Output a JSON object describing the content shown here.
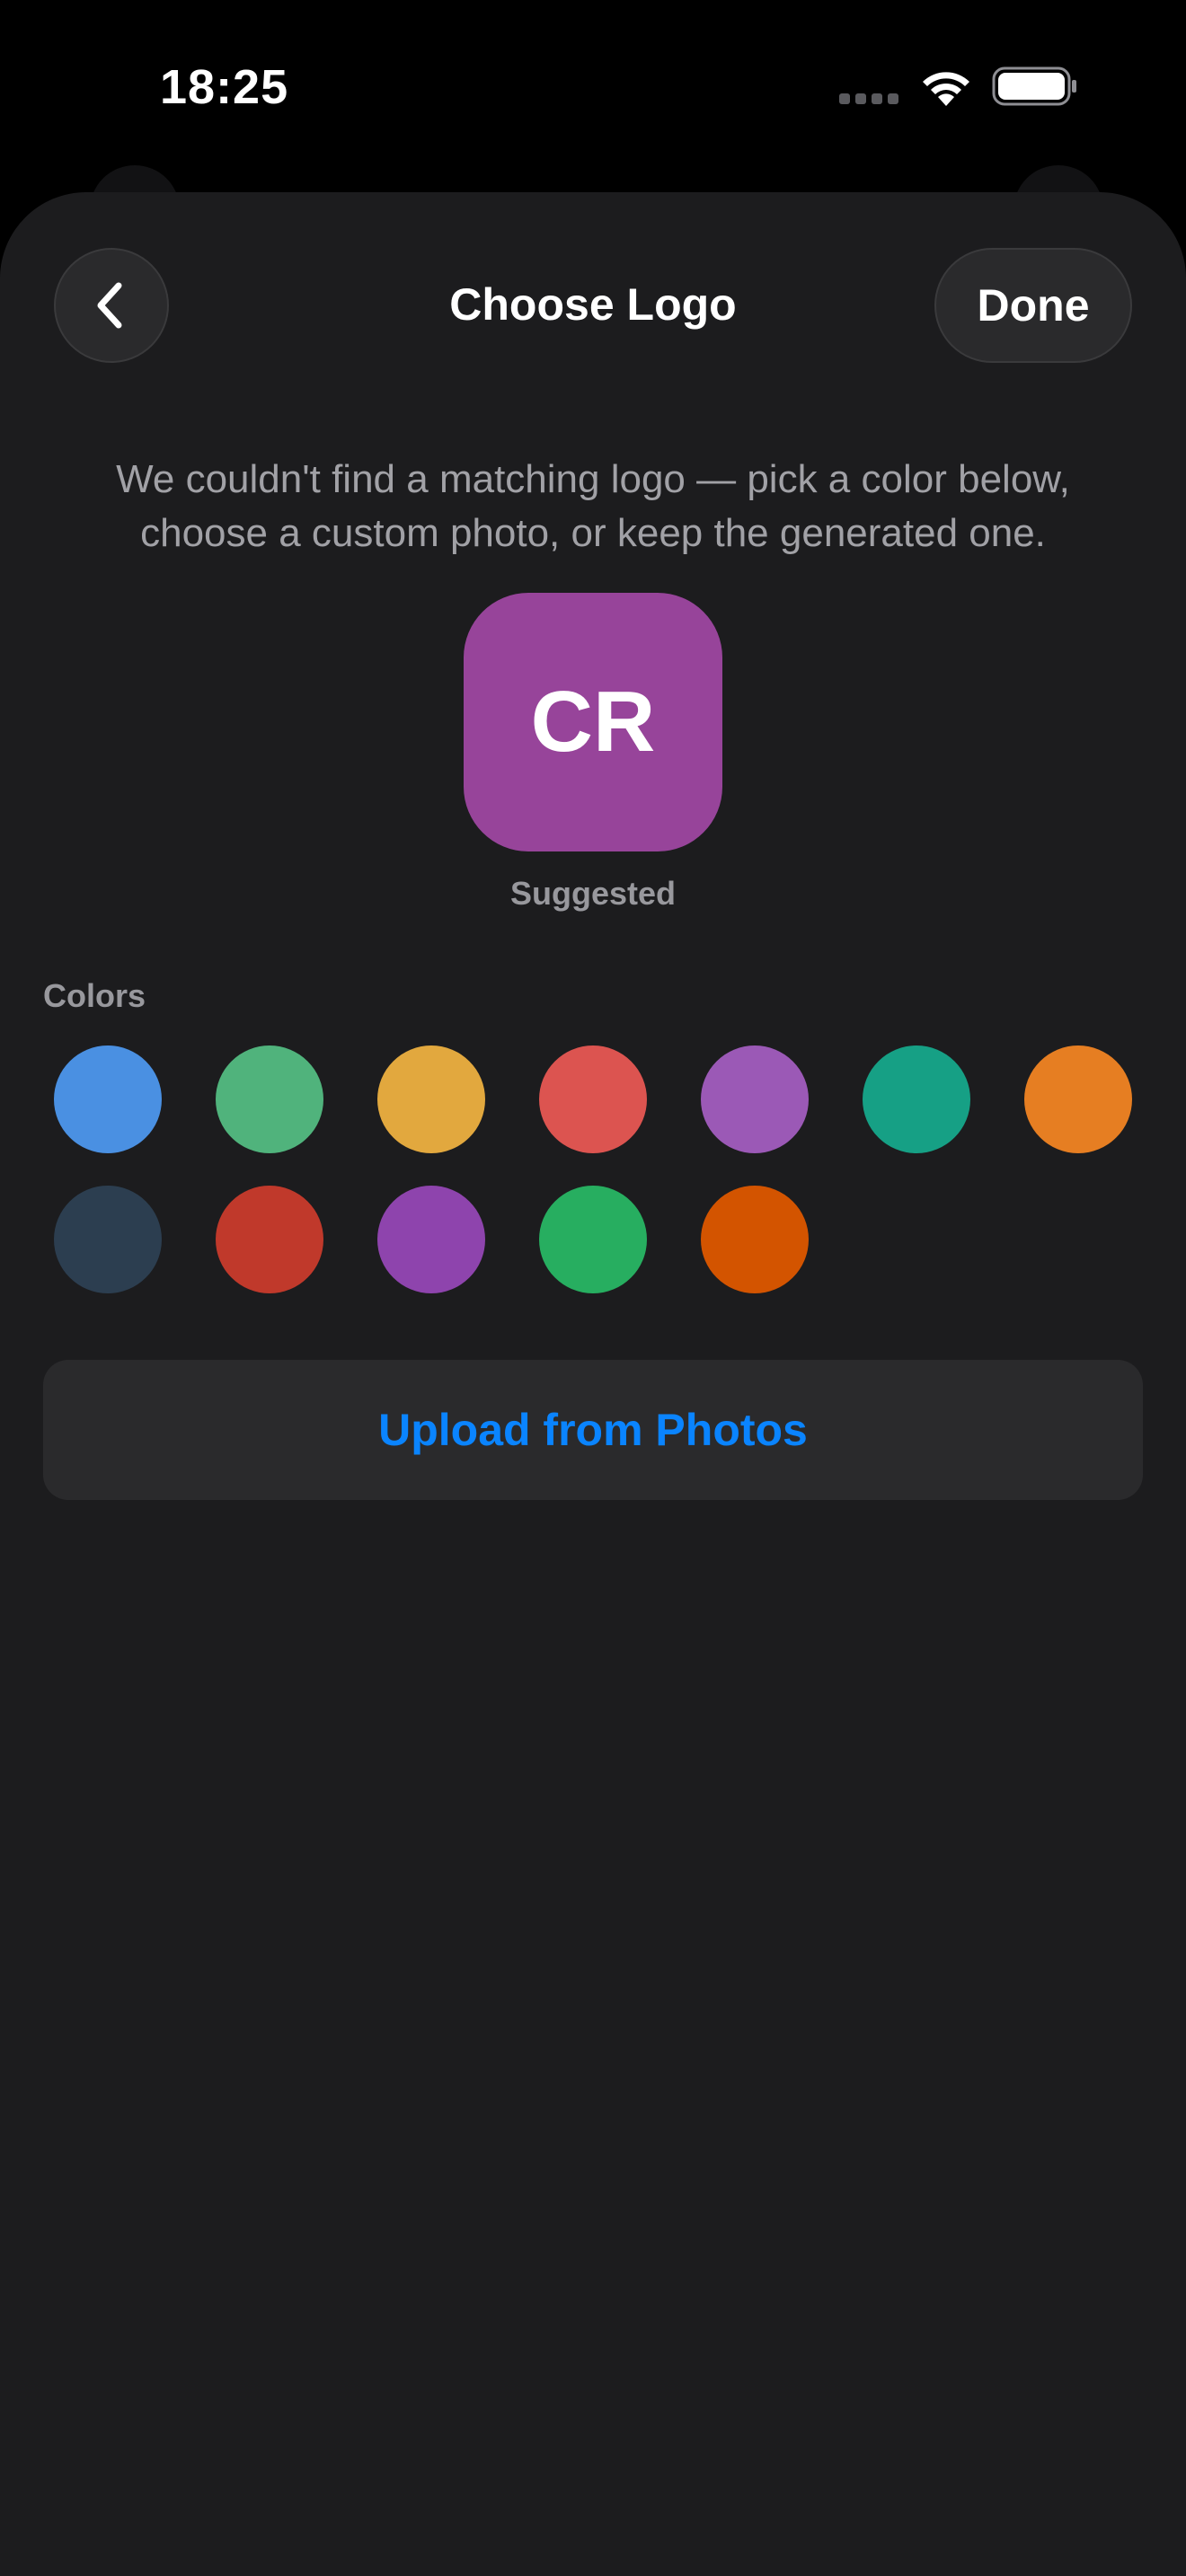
{
  "status_bar": {
    "time": "18:25"
  },
  "header": {
    "title": "Choose Logo",
    "done_label": "Done"
  },
  "description": "We couldn't find a matching logo — pick a color below, choose a custom photo, or keep the generated one.",
  "suggested_logo": {
    "initials": "CR",
    "caption": "Suggested",
    "color": "#97449a"
  },
  "colors": {
    "label": "Colors",
    "swatches": [
      "#4a90e2",
      "#50b37c",
      "#e2a83e",
      "#dc5450",
      "#9b59b6",
      "#16a085",
      "#e67e22",
      "#2c3e50",
      "#c0392b",
      "#8e44ad",
      "#27ae60",
      "#d35400"
    ]
  },
  "upload": {
    "label": "Upload from Photos"
  },
  "accent_color": "#0a84ff"
}
